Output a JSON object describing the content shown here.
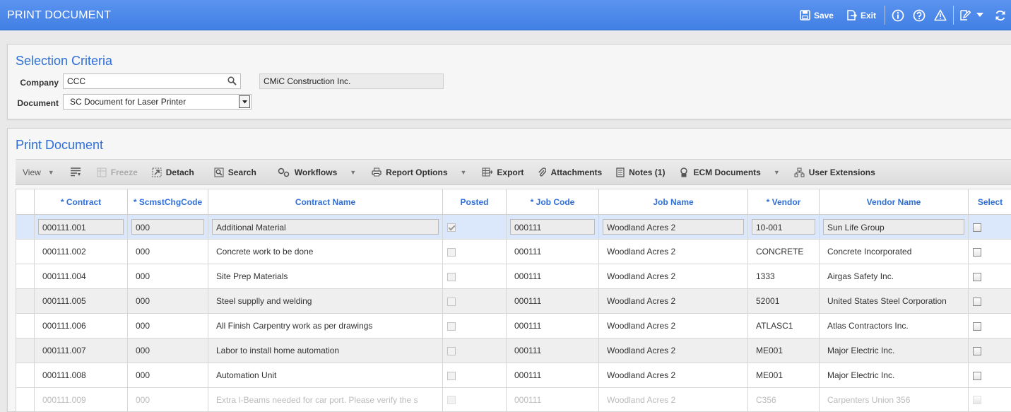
{
  "header": {
    "title": "PRINT DOCUMENT",
    "save_label": "Save",
    "exit_label": "Exit"
  },
  "selection": {
    "title": "Selection Criteria",
    "company_label": "Company",
    "company_value": "CCC",
    "company_name": "CMiC Construction Inc.",
    "document_label": "Document",
    "document_value": "SC Document for Laser Printer"
  },
  "print_panel": {
    "title": "Print Document"
  },
  "toolbar": {
    "view": "View",
    "freeze": "Freeze",
    "detach": "Detach",
    "search": "Search",
    "workflows": "Workflows",
    "report_options": "Report Options",
    "export": "Export",
    "attachments": "Attachments",
    "notes": "Notes (1)",
    "ecm_documents": "ECM Documents",
    "user_extensions": "User Extensions"
  },
  "table": {
    "columns": [
      "* Contract",
      "* ScmstChgCode",
      "Contract Name",
      "Posted",
      "* Job Code",
      "Job Name",
      "* Vendor",
      "Vendor Name",
      "Select"
    ],
    "rows": [
      {
        "contract": "000111.001",
        "code": "000",
        "name": "Additional Material",
        "posted": true,
        "job_code": "000111",
        "job_name": "Woodland Acres 2",
        "vendor": "10-001",
        "vendor_name": "Sun Life Group"
      },
      {
        "contract": "000111.002",
        "code": "000",
        "name": "Concrete work to be done",
        "posted": false,
        "job_code": "000111",
        "job_name": "Woodland Acres 2",
        "vendor": "CONCRETE",
        "vendor_name": "Concrete Incorporated"
      },
      {
        "contract": "000111.004",
        "code": "000",
        "name": "Site Prep Materials",
        "posted": false,
        "job_code": "000111",
        "job_name": "Woodland Acres 2",
        "vendor": "1333",
        "vendor_name": "Airgas Safety Inc."
      },
      {
        "contract": "000111.005",
        "code": "000",
        "name": "Steel supplly and welding",
        "posted": false,
        "job_code": "000111",
        "job_name": "Woodland Acres 2",
        "vendor": "52001",
        "vendor_name": "United States Steel Corporation"
      },
      {
        "contract": "000111.006",
        "code": "000",
        "name": "All Finish Carpentry work as per drawings",
        "posted": false,
        "job_code": "000111",
        "job_name": "Woodland Acres 2",
        "vendor": "ATLASC1",
        "vendor_name": "Atlas Contractors Inc."
      },
      {
        "contract": "000111.007",
        "code": "000",
        "name": "Labor to install home automation",
        "posted": false,
        "job_code": "000111",
        "job_name": "Woodland Acres 2",
        "vendor": "ME001",
        "vendor_name": "Major Electric Inc."
      },
      {
        "contract": "000111.008",
        "code": "000",
        "name": "Automation Unit",
        "posted": false,
        "job_code": "000111",
        "job_name": "Woodland Acres 2",
        "vendor": "ME001",
        "vendor_name": "Major Electric Inc."
      },
      {
        "contract": "000111.009",
        "code": "000",
        "name": "Extra I-Beams needed for car port. Please verify the s",
        "posted": false,
        "job_code": "000111",
        "job_name": "Woodland Acres 2",
        "vendor": "C356",
        "vendor_name": "Carpenters Union 356"
      }
    ]
  }
}
